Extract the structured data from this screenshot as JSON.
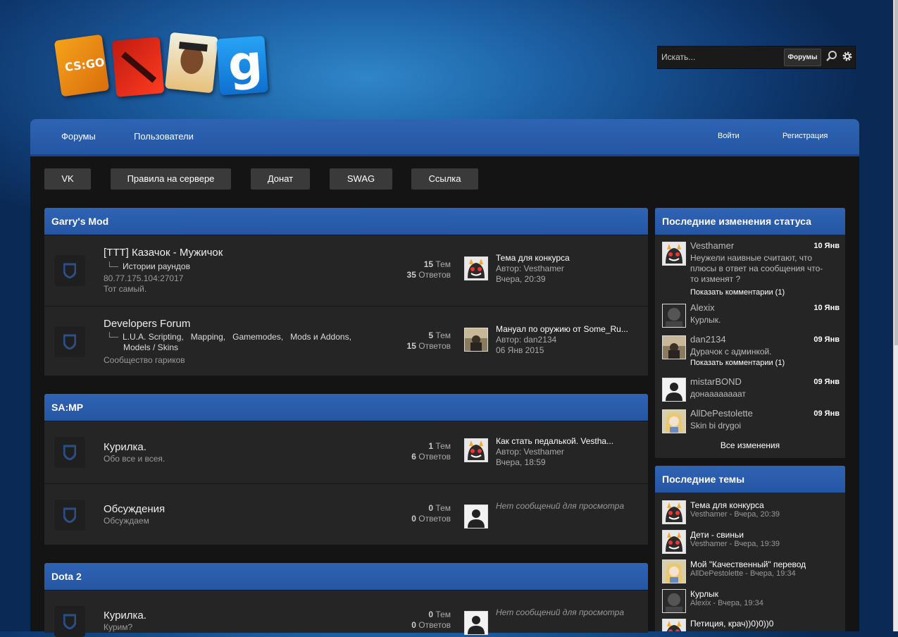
{
  "search": {
    "placeholder": "Искать...",
    "scope_label": "Форумы"
  },
  "nav": {
    "forums": "Форумы",
    "users": "Пользователи",
    "login": "Войти",
    "register": "Регистрация"
  },
  "quick_links": [
    "VK",
    "Правила на сервере",
    "Донат",
    "SWAG",
    "Ссылка"
  ],
  "categories": [
    {
      "title": "Garry's Mod",
      "nodes": [
        {
          "title": "[TTT] Казачок - Мужичок",
          "sub": "Истории раундов",
          "desc1": "80.77.175.104:27017",
          "desc2": "Тот самый.",
          "threads": "15",
          "posts": "35",
          "threads_label": "Тем",
          "posts_label": "Ответов",
          "last_title": "Тема для конкурса",
          "last_author": "Автор: Vesthamer",
          "last_date": "Вчера, 20:39"
        },
        {
          "title": "Developers Forum",
          "sub1": [
            "L.U.A. Scripting",
            "Mapping",
            "Gamemodes",
            "Mods и Addons"
          ],
          "sub2": "Models / Skins",
          "desc1": "Сообщество гариков",
          "threads": "5",
          "posts": "15",
          "threads_label": "Тем",
          "posts_label": "Ответов",
          "last_title": "Мануал по оружию от Some_Ru...",
          "last_author": "Автор: dan2134",
          "last_date": "06 Янв 2015"
        }
      ]
    },
    {
      "title": "SA:MP",
      "nodes": [
        {
          "title": "Курилка.",
          "desc1": "Обо все и всея.",
          "threads": "1",
          "posts": "6",
          "threads_label": "Тем",
          "posts_label": "Ответов",
          "last_title": "Как стать педалькой. Vestha...",
          "last_author": "Автор: Vesthamer",
          "last_date": "Вчера, 18:59"
        },
        {
          "title": "Обсуждения",
          "desc1": "Обсуждаем",
          "threads": "0",
          "posts": "0",
          "threads_label": "Тем",
          "posts_label": "Ответов",
          "last_none": "Нет сообщений для просмотра"
        }
      ]
    },
    {
      "title": "Dota 2",
      "nodes": [
        {
          "title": "Курилка.",
          "desc1": "Курим?",
          "threads": "0",
          "posts": "0",
          "threads_label": "Тем",
          "posts_label": "Ответов",
          "last_none": "Нет сообщений для просмотра"
        }
      ]
    }
  ],
  "status_updates": {
    "title": "Последние изменения статуса",
    "items": [
      {
        "name": "Vesthamer",
        "date": "10 Янв",
        "text": "Неужели наивные считают, что плюсы в ответ на сообщения что-то изменят ?",
        "comments": "Показать комментарии (1)",
        "avatar": "troll"
      },
      {
        "name": "Alexix",
        "date": "10 Янв",
        "text": "Курлык.",
        "avatar": "dark"
      },
      {
        "name": "dan2134",
        "date": "09 Янв",
        "text": "Дурачок с админкой.",
        "comments": "Показать комментарии (1)",
        "avatar": "photo"
      },
      {
        "name": "mistarBOND",
        "date": "09 Янв",
        "text": "донаааааааат",
        "avatar": "default"
      },
      {
        "name": "AllDePestolette",
        "date": "09 Янв",
        "text": "Skin bi drygoi",
        "avatar": "anime"
      }
    ],
    "all_label": "Все изменения"
  },
  "latest_threads": {
    "title": "Последние темы",
    "items": [
      {
        "title": "Тема для конкурса",
        "meta": "Vesthamer - Вчера, 20:39",
        "avatar": "troll"
      },
      {
        "title": "Дети - свиньи",
        "meta": "Vesthamer - Вчера, 19:39",
        "avatar": "troll"
      },
      {
        "title": "Мой \"Качественный\" перевод",
        "meta": "AllDePestolette - Вчера, 19:34",
        "avatar": "anime"
      },
      {
        "title": "Курлык",
        "meta": "Alexix - Вчера, 19:34",
        "avatar": "dark"
      },
      {
        "title": "Петиция, крач))0)0))0",
        "meta": "",
        "avatar": "troll"
      }
    ]
  },
  "colors": {
    "accent": "#2a5aa8",
    "panel": "#252525",
    "content_bg": "#141414"
  }
}
